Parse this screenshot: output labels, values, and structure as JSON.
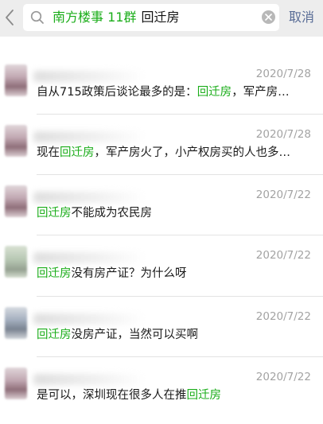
{
  "search": {
    "tag": "南方楼事 11群",
    "query": "回迁房",
    "cancel_label": "取消"
  },
  "icons": {
    "back": "chevron-left-icon",
    "search": "search-icon",
    "clear": "clear-icon"
  },
  "colors": {
    "highlight": "#1aad19",
    "cancel": "#576b95",
    "date": "#a3a3a3"
  },
  "results": [
    {
      "date": "2020/7/28",
      "segments": [
        {
          "text": "自从715政策后谈论最多的是：",
          "hl": false
        },
        {
          "text": "回迁房",
          "hl": true
        },
        {
          "text": "，军产房…",
          "hl": false
        }
      ]
    },
    {
      "date": "2020/7/28",
      "segments": [
        {
          "text": "现在",
          "hl": false
        },
        {
          "text": "回迁房",
          "hl": true
        },
        {
          "text": "，军产房火了，小产权房买的人也多…",
          "hl": false
        }
      ]
    },
    {
      "date": "2020/7/22",
      "segments": [
        {
          "text": "回迁房",
          "hl": true
        },
        {
          "text": "不能成为农民房",
          "hl": false
        }
      ]
    },
    {
      "date": "2020/7/22",
      "segments": [
        {
          "text": "回迁房",
          "hl": true
        },
        {
          "text": "没有房产证？为什么呀",
          "hl": false
        }
      ]
    },
    {
      "date": "2020/7/22",
      "segments": [
        {
          "text": "回迁房",
          "hl": true
        },
        {
          "text": "没房产证，当然可以买啊",
          "hl": false
        }
      ]
    },
    {
      "date": "2020/7/22",
      "segments": [
        {
          "text": "是可以，深圳现在很多人在推",
          "hl": false
        },
        {
          "text": "回迁房",
          "hl": true
        }
      ]
    }
  ]
}
